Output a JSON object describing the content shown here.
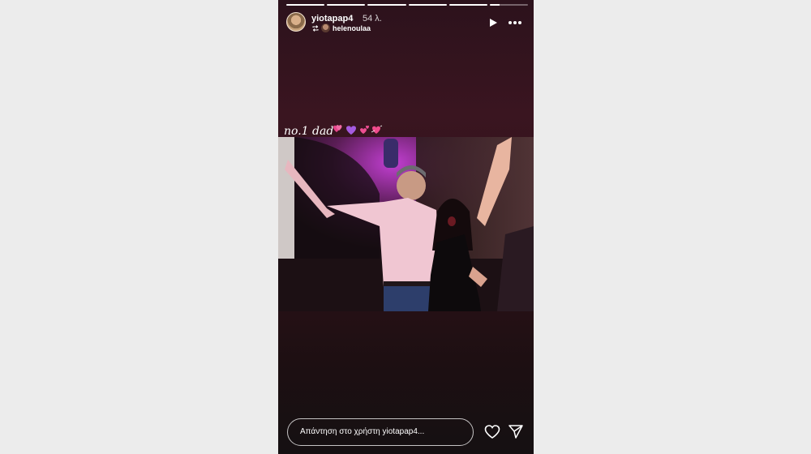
{
  "story": {
    "progress": [
      1,
      1,
      1,
      1,
      1,
      0.25
    ],
    "username": "yiotapap4",
    "timestamp": "54 λ.",
    "reposted_from": "helenoulaa",
    "caption": "no.1 dad",
    "reply_placeholder": "Απάντηση στο χρήστη yiotapap4..."
  },
  "icons": {
    "play": "play-icon",
    "more": "more-options-icon",
    "repost": "repost-icon",
    "like": "heart-icon",
    "share": "send-icon"
  },
  "colors": {
    "background": "#ececec",
    "story_bg": "#2c121c",
    "accent_pink": "#e8458b",
    "accent_purple": "#a55be0"
  }
}
